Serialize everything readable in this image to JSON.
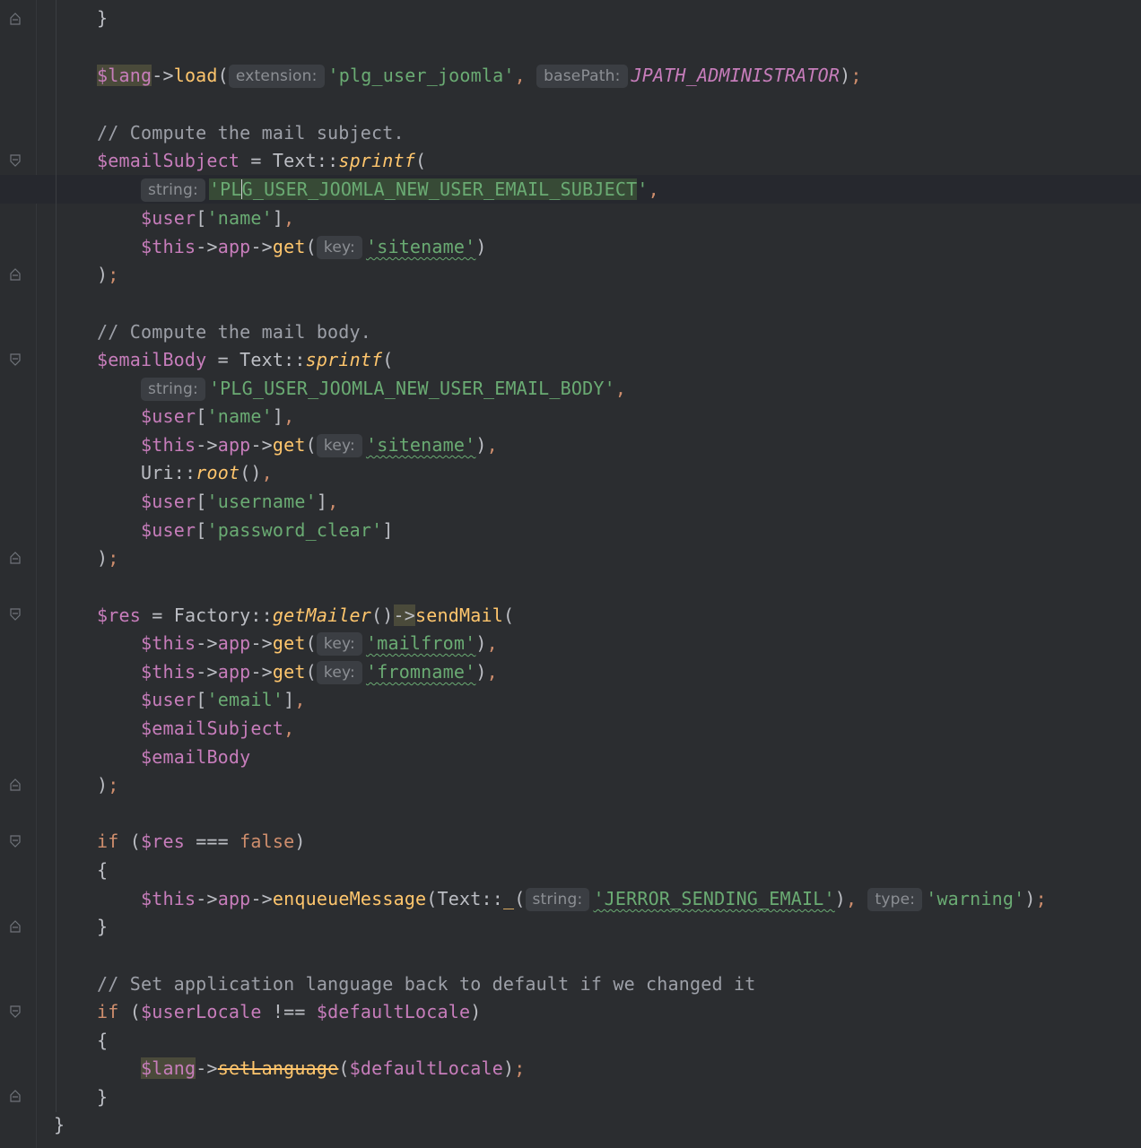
{
  "lines": {
    "l0": "}",
    "l1_var": "$lang",
    "l1_method": "load",
    "l1_hint1": "extension:",
    "l1_str1": "'plg_user_joomla'",
    "l1_hint2": "basePath:",
    "l1_const": "JPATH_ADMINISTRATOR",
    "c1": "// Compute the mail subject.",
    "l2_var": "$emailSubject",
    "l2_cls": "Text",
    "l2_smeth": "sprintf",
    "l3_hint": "string:",
    "l3_str_a": "'PL",
    "l3_str_b": "G_USER_JOOMLA_NEW_USER_EMAIL_SUBJECT",
    "l3_str_c": "'",
    "l4_var": "$user",
    "l4_str": "'name'",
    "l5_var": "$this",
    "l5_app": "app",
    "l5_get": "get",
    "l5_hint": "key:",
    "l5_str": "'sitename'",
    "close": ");",
    "c2": "// Compute the mail body.",
    "l6_var": "$emailBody",
    "l6_cls": "Text",
    "l6_smeth": "sprintf",
    "l7_hint": "string:",
    "l7_str": "'PLG_USER_JOOMLA_NEW_USER_EMAIL_BODY'",
    "l8_var": "$user",
    "l8_str": "'name'",
    "l9_var": "$this",
    "l9_app": "app",
    "l9_get": "get",
    "l9_hint": "key:",
    "l9_str": "'sitename'",
    "l10_cls": "Uri",
    "l10_smeth": "root",
    "l11_var": "$user",
    "l11_str": "'username'",
    "l12_var": "$user",
    "l12_str": "'password_clear'",
    "l13_var": "$res",
    "l13_cls": "Factory",
    "l13_smeth": "getMailer",
    "l13_method": "sendMail",
    "l14_var": "$this",
    "l14_app": "app",
    "l14_get": "get",
    "l14_hint": "key:",
    "l14_str": "'mailfrom'",
    "l15_var": "$this",
    "l15_app": "app",
    "l15_get": "get",
    "l15_hint": "key:",
    "l15_str": "'fromname'",
    "l16_var": "$user",
    "l16_str": "'email'",
    "l17_var": "$emailSubject",
    "l18_var": "$emailBody",
    "l19_kw": "if",
    "l19_var": "$res",
    "l19_op": "===",
    "l19_kw2": "false",
    "open_brace": "{",
    "l20_var": "$this",
    "l20_app": "app",
    "l20_method": "enqueueMessage",
    "l20_cls": "Text",
    "l20_fn": "_",
    "l20_hint1": "string:",
    "l20_str1": "'JERROR_SENDING_EMAIL'",
    "l20_hint2": "type:",
    "l20_str2": "'warning'",
    "close_brace": "}",
    "c3": "// Set application language back to default if we changed it",
    "l21_kw": "if",
    "l21_var1": "$userLocale",
    "l21_op": "!==",
    "l21_var2": "$defaultLocale",
    "l22_var": "$lang",
    "l22_method": "setLanguage",
    "l22_var2": "$defaultLocale",
    "end_brace": "}"
  }
}
